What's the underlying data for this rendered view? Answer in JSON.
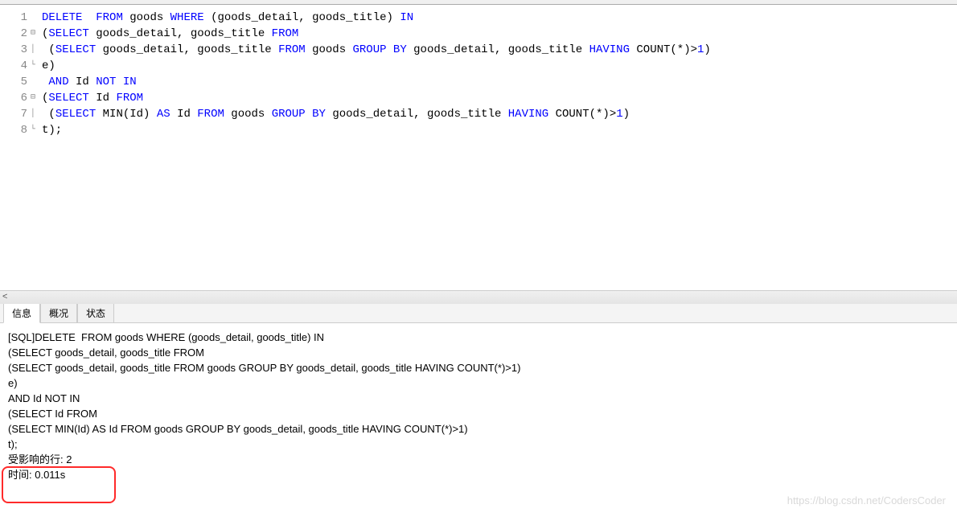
{
  "editor": {
    "lines": [
      {
        "n": "1",
        "fold": "",
        "tokens": [
          {
            "t": "DELETE",
            "c": "kw"
          },
          {
            "t": "  ",
            "c": ""
          },
          {
            "t": "FROM",
            "c": "kw"
          },
          {
            "t": " goods ",
            "c": ""
          },
          {
            "t": "WHERE",
            "c": "kw"
          },
          {
            "t": " (goods_detail, goods_title) ",
            "c": ""
          },
          {
            "t": "IN",
            "c": "kw"
          }
        ]
      },
      {
        "n": "2",
        "fold": "⊟",
        "tokens": [
          {
            "t": "(",
            "c": ""
          },
          {
            "t": "SELECT",
            "c": "kw"
          },
          {
            "t": " goods_detail, goods_title ",
            "c": ""
          },
          {
            "t": "FROM",
            "c": "kw"
          }
        ]
      },
      {
        "n": "3",
        "fold": "│",
        "tokens": [
          {
            "t": " (",
            "c": ""
          },
          {
            "t": "SELECT",
            "c": "kw"
          },
          {
            "t": " goods_detail, goods_title ",
            "c": ""
          },
          {
            "t": "FROM",
            "c": "kw"
          },
          {
            "t": " goods ",
            "c": ""
          },
          {
            "t": "GROUP",
            "c": "kw"
          },
          {
            "t": " ",
            "c": ""
          },
          {
            "t": "BY",
            "c": "kw"
          },
          {
            "t": " goods_detail, goods_title ",
            "c": ""
          },
          {
            "t": "HAVING",
            "c": "kw"
          },
          {
            "t": " COUNT(*)>",
            "c": ""
          },
          {
            "t": "1",
            "c": "num"
          },
          {
            "t": ")",
            "c": ""
          }
        ]
      },
      {
        "n": "4",
        "fold": "└",
        "tokens": [
          {
            "t": "e)",
            "c": ""
          }
        ]
      },
      {
        "n": "5",
        "fold": "",
        "tokens": [
          {
            "t": " ",
            "c": ""
          },
          {
            "t": "AND",
            "c": "kw"
          },
          {
            "t": " Id ",
            "c": ""
          },
          {
            "t": "NOT",
            "c": "kw"
          },
          {
            "t": " ",
            "c": ""
          },
          {
            "t": "IN",
            "c": "kw"
          }
        ]
      },
      {
        "n": "6",
        "fold": "⊟",
        "tokens": [
          {
            "t": "(",
            "c": ""
          },
          {
            "t": "SELECT",
            "c": "kw"
          },
          {
            "t": " Id ",
            "c": ""
          },
          {
            "t": "FROM",
            "c": "kw"
          }
        ]
      },
      {
        "n": "7",
        "fold": "│",
        "tokens": [
          {
            "t": " (",
            "c": ""
          },
          {
            "t": "SELECT",
            "c": "kw"
          },
          {
            "t": " MIN(Id) ",
            "c": ""
          },
          {
            "t": "AS",
            "c": "kw"
          },
          {
            "t": " Id ",
            "c": ""
          },
          {
            "t": "FROM",
            "c": "kw"
          },
          {
            "t": " goods ",
            "c": ""
          },
          {
            "t": "GROUP",
            "c": "kw"
          },
          {
            "t": " ",
            "c": ""
          },
          {
            "t": "BY",
            "c": "kw"
          },
          {
            "t": " goods_detail, goods_title ",
            "c": ""
          },
          {
            "t": "HAVING",
            "c": "kw"
          },
          {
            "t": " COUNT(*)>",
            "c": ""
          },
          {
            "t": "1",
            "c": "num"
          },
          {
            "t": ")",
            "c": ""
          }
        ]
      },
      {
        "n": "8",
        "fold": "└",
        "tokens": [
          {
            "t": "t);",
            "c": ""
          }
        ]
      }
    ]
  },
  "tabs": {
    "items": [
      {
        "label": "信息",
        "active": true
      },
      {
        "label": "概况",
        "active": false
      },
      {
        "label": "状态",
        "active": false
      }
    ]
  },
  "result": {
    "lines": [
      "[SQL]DELETE  FROM goods WHERE (goods_detail, goods_title) IN",
      "(SELECT goods_detail, goods_title FROM",
      "(SELECT goods_detail, goods_title FROM goods GROUP BY goods_detail, goods_title HAVING COUNT(*)>1)",
      "e)",
      "AND Id NOT IN",
      "(SELECT Id FROM",
      "(SELECT MIN(Id) AS Id FROM goods GROUP BY goods_detail, goods_title HAVING COUNT(*)>1)",
      "t);"
    ],
    "affected_rows_label": "受影响的行: 2",
    "time_label": "时间: 0.011s"
  },
  "watermark": "https://blog.csdn.net/CodersCoder"
}
